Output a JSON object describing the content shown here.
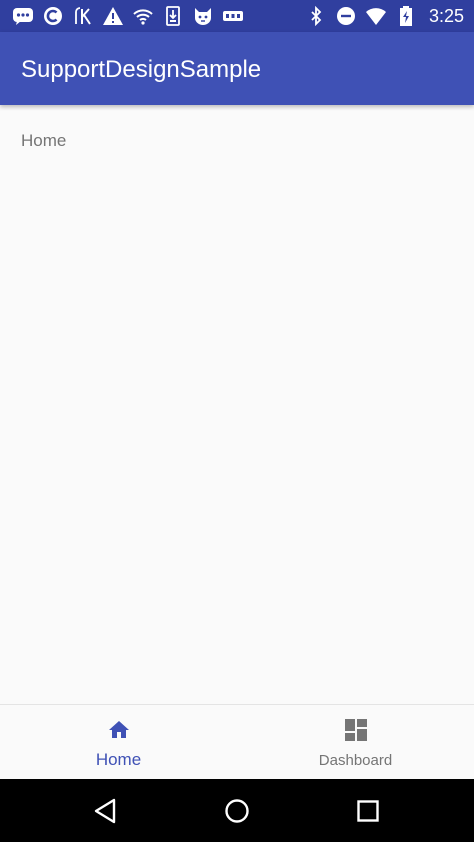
{
  "status_bar": {
    "time": "3:25",
    "background": "#303F9F",
    "left_icons": [
      "chat-icon",
      "c-app-icon",
      "k-app-icon",
      "warning-icon",
      "wifi-notification-icon",
      "download-icon",
      "cat-icon",
      "nhk-app-icon"
    ],
    "right_icons": [
      "bluetooth-icon",
      "do-not-disturb-icon",
      "wifi-signal-icon",
      "battery-charging-icon"
    ]
  },
  "app_bar": {
    "title": "SupportDesignSample",
    "background": "#3F51B5"
  },
  "content": {
    "text": "Home",
    "text_color": "#757575"
  },
  "bottom_nav": {
    "items": [
      {
        "label": "Home",
        "icon": "home-icon",
        "selected": true
      },
      {
        "label": "Dashboard",
        "icon": "dashboard-icon",
        "selected": false
      }
    ],
    "active_color": "#3F51B5",
    "inactive_color": "#757575"
  },
  "system_nav": {
    "buttons": [
      "back-icon",
      "home-circle-icon",
      "recents-icon"
    ]
  }
}
